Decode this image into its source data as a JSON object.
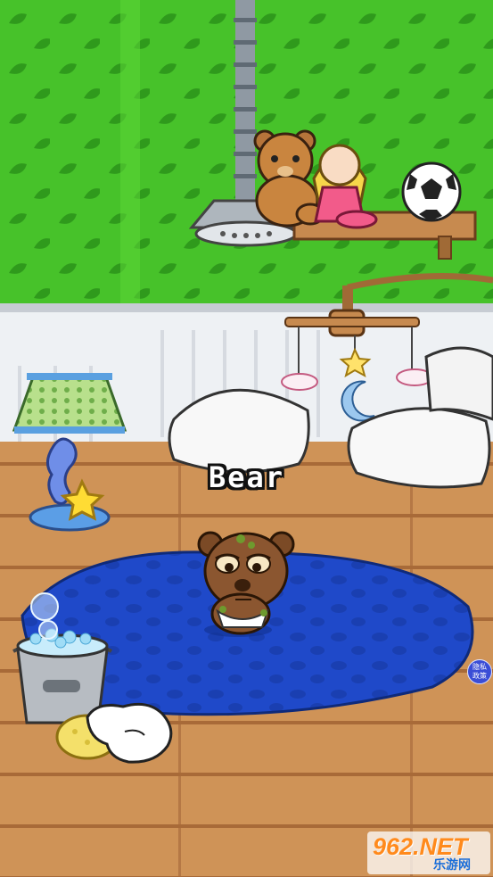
{
  "pet": {
    "name": "Bear"
  },
  "privacy_button": {
    "label": "隐私\n政策",
    "line1": "隐私",
    "line2": "政策"
  },
  "watermark": {
    "brand": "962.NET",
    "sub": "乐游网"
  },
  "icons": [
    "shower-icon",
    "teddy-bear-icon",
    "doll-icon",
    "soccer-ball-icon",
    "lamp-icon",
    "seahorse-icon",
    "star-icon",
    "crib-mobile-icon",
    "pillow-icon",
    "soap-bucket-icon",
    "sponge-icon",
    "glove-hand-icon",
    "bubble-icon",
    "rug"
  ],
  "colors": {
    "wall": "#4cc62a",
    "floor": "#c98a4e",
    "rug": "#1f49c9",
    "privacy": "#3a4dd6",
    "brand": "#ff8a1c"
  }
}
